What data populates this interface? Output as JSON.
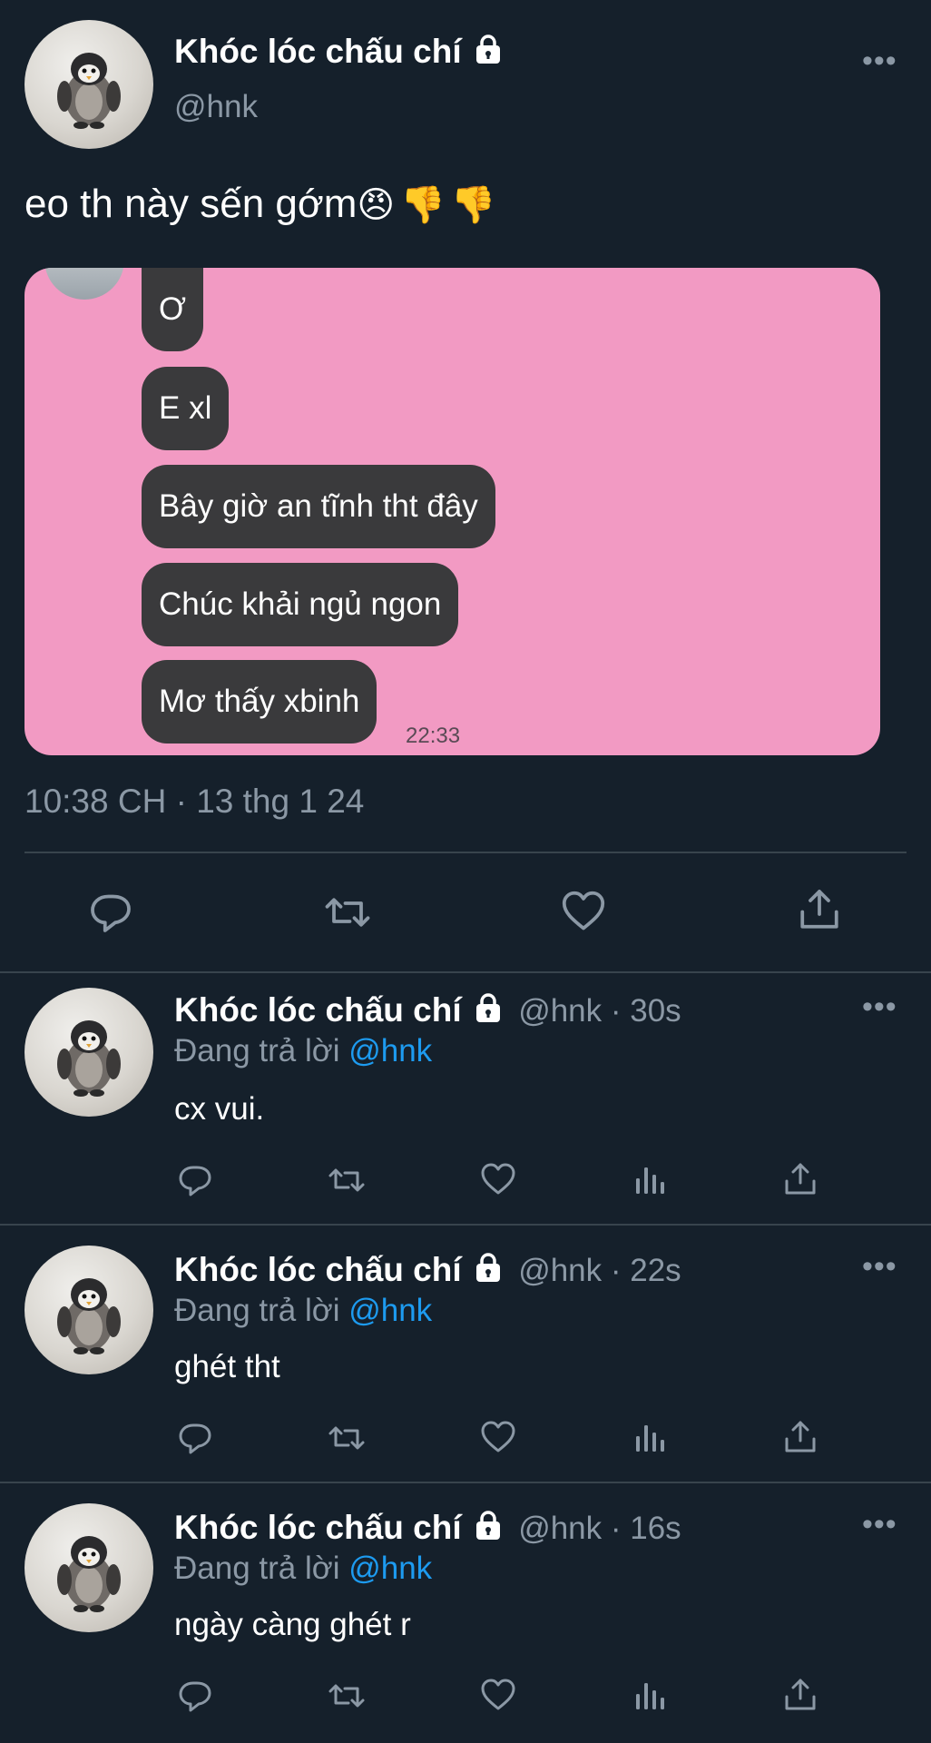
{
  "main_tweet": {
    "display_name": "Khóc lóc chấu chí",
    "handle": "@hnk",
    "text": "eo th này sến gớm",
    "emojis": [
      "😠",
      "👎",
      "👎"
    ],
    "timestamp": "10:38 CH · 13 thg 1 24",
    "more_label": "•••",
    "actions": [
      "reply-icon",
      "retweet-icon",
      "like-icon",
      "share-icon"
    ]
  },
  "image": {
    "background": "#f29ac3",
    "messages": [
      "Ơ",
      "E xl",
      "Bây giờ an tĩnh tht đây",
      "Chúc khải ngủ ngon",
      "Mơ thấy xbinh"
    ],
    "time": "22:33"
  },
  "replies": [
    {
      "display_name": "Khóc lóc chấu chí",
      "handle_time": "@hnk · 30s",
      "replying_prefix": "Đang trả lời",
      "replying_to": "@hnk",
      "text": "cx vui.",
      "more_label": "•••"
    },
    {
      "display_name": "Khóc lóc chấu chí",
      "handle_time": "@hnk · 22s",
      "replying_prefix": "Đang trả lời",
      "replying_to": "@hnk",
      "text": "ghét tht",
      "more_label": "•••"
    },
    {
      "display_name": "Khóc lóc chấu chí",
      "handle_time": "@hnk · 16s",
      "replying_prefix": "Đang trả lời",
      "replying_to": "@hnk",
      "text": "ngày càng ghét r",
      "more_label": "•••"
    }
  ],
  "colors": {
    "background": "#15202b",
    "text": "#ffffff",
    "secondary": "#8b98a5",
    "link": "#1d9bf0",
    "divider": "#38444d"
  }
}
